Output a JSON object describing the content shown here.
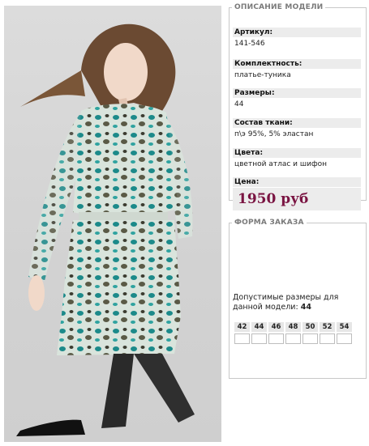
{
  "description": {
    "legend": "ОПИСАНИЕ МОДЕЛИ",
    "article_label": "Артикул:",
    "article_value": "141-546",
    "set_label": "Комплектность:",
    "set_value": "платье-туника",
    "sizes_label": "Размеры:",
    "sizes_value": "44",
    "fabric_label": "Состав ткани:",
    "fabric_value": "п\\э 95%, 5% эластан",
    "colors_label": "Цвета:",
    "colors_value": "цветной атлас и шифон",
    "price_label": "Цена:",
    "price_value": "1950 руб",
    "price_color": "#7a1442"
  },
  "order": {
    "legend": "ФОРМА ЗАКАЗА",
    "allowed_text": "Допустимые размеры для данной модели:",
    "allowed_value": "44",
    "size_headers": [
      "42",
      "44",
      "46",
      "48",
      "50",
      "52",
      "54"
    ]
  }
}
